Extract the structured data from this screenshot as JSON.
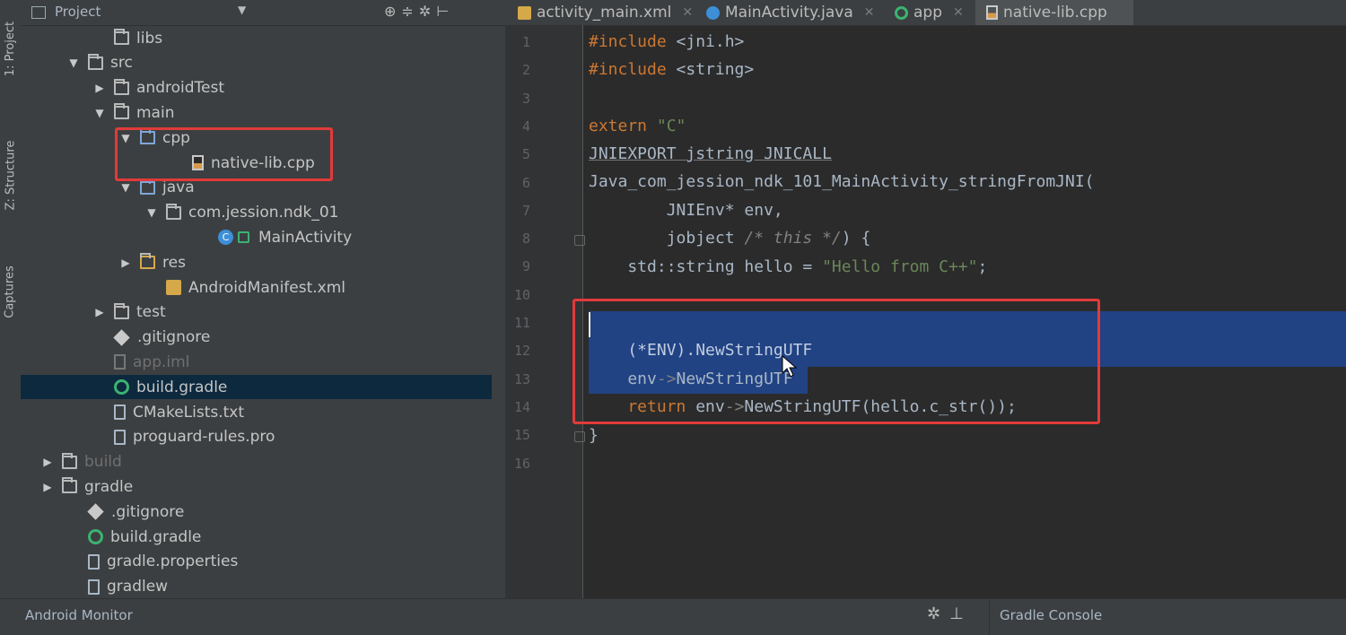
{
  "side_tabs": {
    "project": "1: Project",
    "structure": "Z: Structure",
    "captures": "Captures"
  },
  "project_panel": {
    "title": "Project",
    "tree": [
      {
        "label": "libs",
        "icon": "folder-icon",
        "depth": 4,
        "arrow": ""
      },
      {
        "label": "src",
        "icon": "folder-icon",
        "depth": 3,
        "arrow": "▼"
      },
      {
        "label": "androidTest",
        "icon": "folder-icon",
        "depth": 4,
        "arrow": "▶"
      },
      {
        "label": "main",
        "icon": "folder-icon",
        "depth": 4,
        "arrow": "▼"
      },
      {
        "label": "cpp",
        "icon": "folder-blue-icon",
        "depth": 5,
        "arrow": "▼"
      },
      {
        "label": "native-lib.cpp",
        "icon": "cpp-file-icon",
        "depth": 7,
        "arrow": ""
      },
      {
        "label": "java",
        "icon": "folder-blue-icon",
        "depth": 5,
        "arrow": "▼"
      },
      {
        "label": "com.jession.ndk_01",
        "icon": "package-icon",
        "depth": 6,
        "arrow": "▼"
      },
      {
        "label": "MainActivity",
        "icon": "class-icon",
        "depth": 8,
        "arrow": ""
      },
      {
        "label": "res",
        "icon": "res-folder-icon",
        "depth": 5,
        "arrow": "▶"
      },
      {
        "label": "AndroidManifest.xml",
        "icon": "xml-file-icon",
        "depth": 6,
        "arrow": ""
      },
      {
        "label": "test",
        "icon": "folder-icon",
        "depth": 4,
        "arrow": "▶"
      },
      {
        "label": ".gitignore",
        "icon": "git-icon",
        "depth": 4,
        "arrow": ""
      },
      {
        "label": "app.iml",
        "icon": "iml-file-icon",
        "depth": 4,
        "arrow": "",
        "dim": true
      },
      {
        "label": "build.gradle",
        "icon": "gradle-icon",
        "depth": 4,
        "arrow": "",
        "selected": true
      },
      {
        "label": "CMakeLists.txt",
        "icon": "text-file-icon",
        "depth": 4,
        "arrow": ""
      },
      {
        "label": "proguard-rules.pro",
        "icon": "text-file-icon",
        "depth": 4,
        "arrow": ""
      },
      {
        "label": "build",
        "icon": "folder-icon",
        "depth": 2,
        "arrow": "▶",
        "dim": true
      },
      {
        "label": "gradle",
        "icon": "folder-icon",
        "depth": 2,
        "arrow": "▶"
      },
      {
        "label": ".gitignore",
        "icon": "git-icon",
        "depth": 3,
        "arrow": ""
      },
      {
        "label": "build.gradle",
        "icon": "gradle-icon",
        "depth": 3,
        "arrow": ""
      },
      {
        "label": "gradle.properties",
        "icon": "properties-file-icon",
        "depth": 3,
        "arrow": ""
      },
      {
        "label": "gradlew",
        "icon": "text-file-icon",
        "depth": 3,
        "arrow": ""
      }
    ]
  },
  "tabs": [
    {
      "label": "activity_main.xml",
      "icon": "xml-file-icon"
    },
    {
      "label": "MainActivity.java",
      "icon": "class-icon"
    },
    {
      "label": "app",
      "icon": "gradle-icon"
    },
    {
      "label": "native-lib.cpp",
      "icon": "cpp-file-icon",
      "active": true
    }
  ],
  "editor": {
    "line_numbers": [
      "1",
      "2",
      "3",
      "4",
      "5",
      "6",
      "7",
      "8",
      "9",
      "10",
      "11",
      "12",
      "13",
      "14",
      "15",
      "16"
    ],
    "lines": {
      "l1a": "#include",
      "l1b": " <jni.h>",
      "l2a": "#include",
      "l2b": " <string>",
      "l4a": "extern",
      "l4b": " \"C\"",
      "l5": "JNIEXPORT jstring JNICALL",
      "l6": "Java_com_jession_ndk_101_MainActivity_stringFromJNI(",
      "l7": "        JNIEnv* env,",
      "l8a": "        jobject",
      "l8b": " /* this */",
      "l8c": ") {",
      "l9a": "    std::string hello = ",
      "l9b": "\"Hello from C++\"",
      "l9c": ";",
      "l12": "    (*ENV).NewStringUTF",
      "l13a": "    env",
      "l13b": "->",
      "l13c": "NewStringUTF",
      "l14a": "    return",
      "l14b": " env",
      "l14c": "->",
      "l14d": "NewStringUTF(hello.c_str());",
      "l15": "}"
    }
  },
  "bottom_bar": {
    "android_monitor": "Android Monitor",
    "gradle_console": "Gradle Console"
  }
}
